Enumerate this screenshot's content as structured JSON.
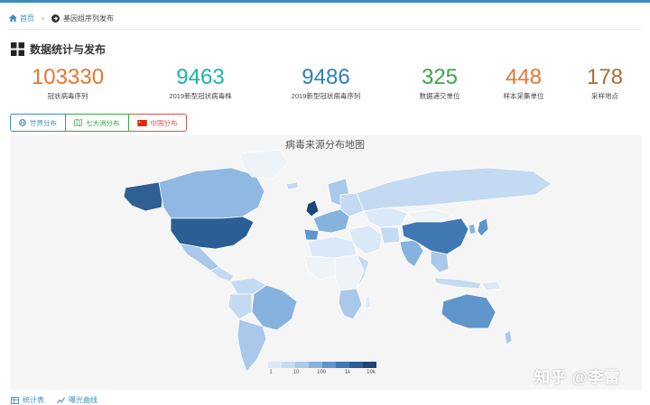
{
  "breadcrumb": {
    "home_label": "首页",
    "current_label": "基因组序列发布"
  },
  "section": {
    "title": "数据统计与发布"
  },
  "stats": [
    {
      "value": "103330",
      "label": "冠状病毒序列",
      "color": "#e8762c"
    },
    {
      "value": "9463",
      "label": "2019新型冠状病毒株",
      "color": "#1bb5a5"
    },
    {
      "value": "9486",
      "label": "2019新型冠状病毒序列",
      "color": "#2d7fb8"
    },
    {
      "value": "325",
      "label": "数据递交单位",
      "color": "#3aa64a"
    },
    {
      "value": "448",
      "label": "样本采集单位",
      "color": "#e8762c"
    },
    {
      "value": "178",
      "label": "采样地点",
      "color": "#a86d32"
    }
  ],
  "tabs": [
    {
      "label": "世界分布",
      "icon": "globe-icon",
      "active": true
    },
    {
      "label": "七大洲分布",
      "icon": "map-icon",
      "active": false
    },
    {
      "label": "中国分布",
      "icon": "china-flag-icon",
      "active": false
    }
  ],
  "map": {
    "title": "病毒来源分布地图",
    "legend_ticks": [
      "1",
      "10",
      "100",
      "1k",
      "10k"
    ],
    "legend_colors": [
      "#dbe8f7",
      "#c4daf2",
      "#a9c8ea",
      "#86b2de",
      "#5f95cb",
      "#3f78b2",
      "#2a5e95",
      "#1b4677"
    ],
    "high_regions": [
      "United States",
      "China",
      "United Kingdom"
    ],
    "mid_regions": [
      "Australia",
      "Canada",
      "Japan",
      "Brazil",
      "India"
    ],
    "low_regions": [
      "Russia",
      "Europe",
      "South America",
      "Africa"
    ]
  },
  "bottom_links": [
    {
      "label": "统计表",
      "icon": "table-icon"
    },
    {
      "label": "曝光曲线",
      "icon": "line-chart-icon"
    }
  ],
  "watermark": "知乎 @李雷"
}
